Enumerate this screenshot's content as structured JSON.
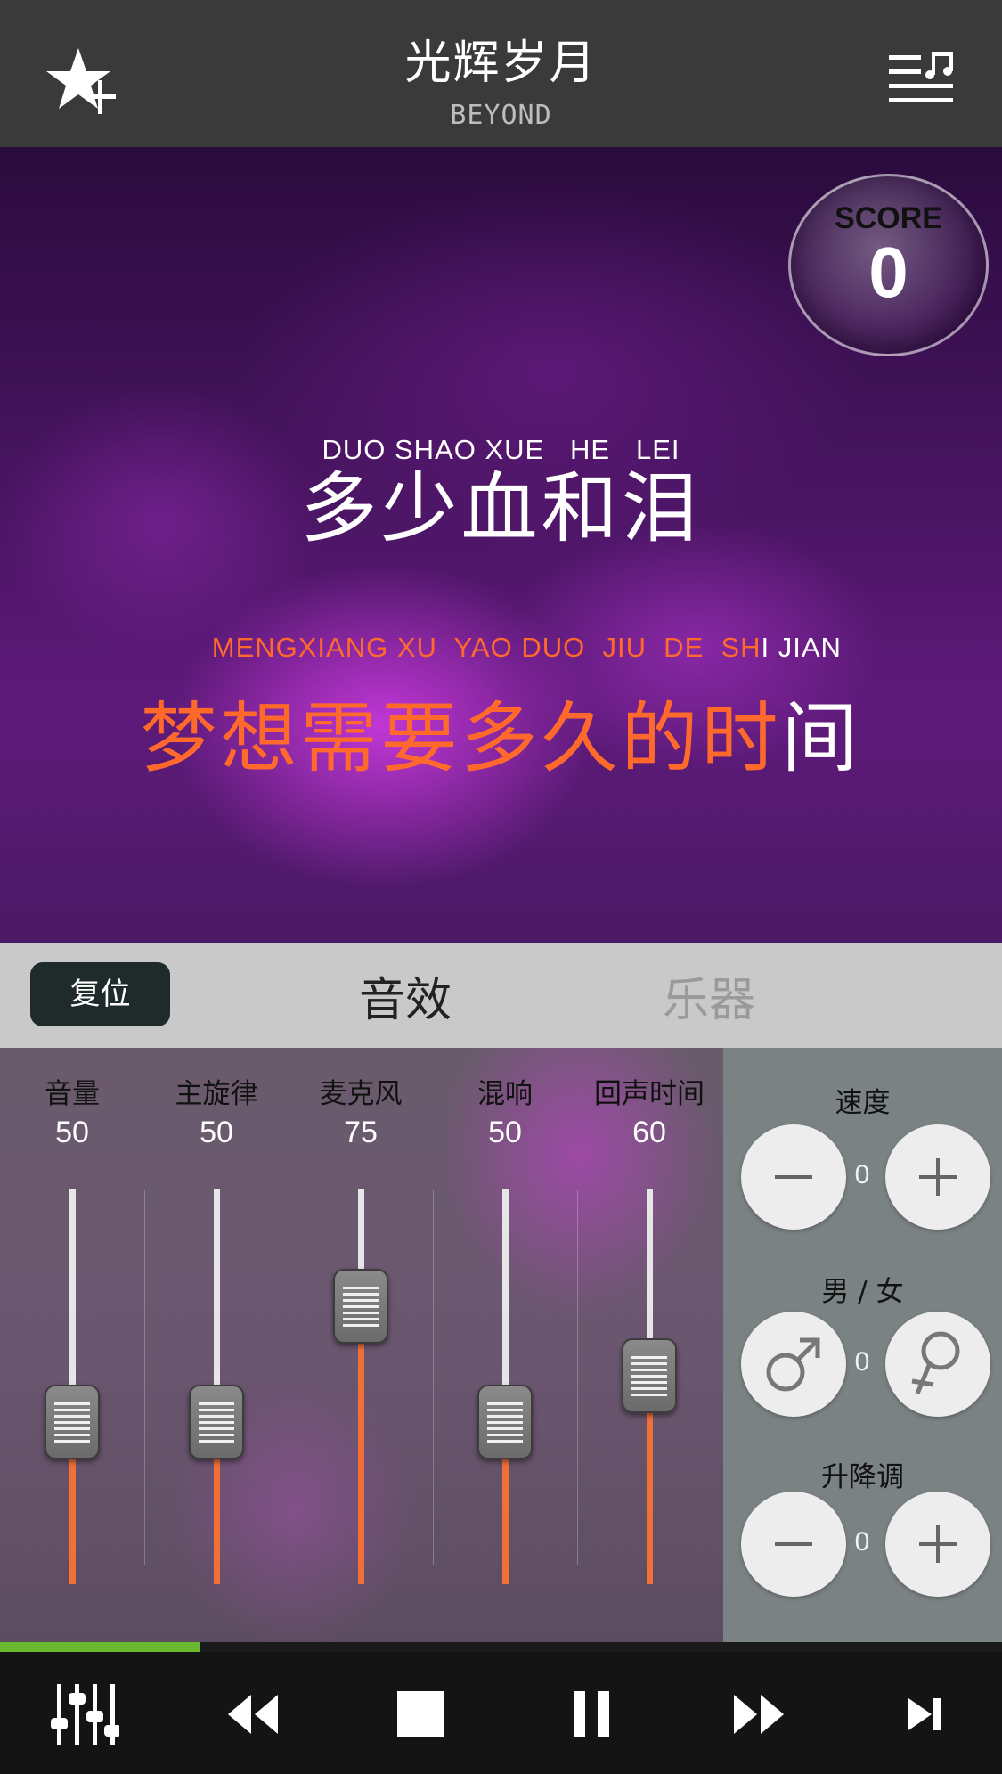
{
  "header": {
    "title": "光辉岁月",
    "artist": "BEYOND",
    "icons": {
      "favorite": "star-plus-icon",
      "playlist": "music-list-icon"
    }
  },
  "stage": {
    "score_label": "SCORE",
    "score_value": "0",
    "line1": {
      "pinyin": "DUO SHAO XUE   HE   LEI",
      "hanzi": "多少血和泪"
    },
    "line2": {
      "pinyin_sung": "MENGXIANG XU  YAO DUO  JIU  DE  SH",
      "pinyin_unsung": "I JIAN",
      "hanzi_sung": "梦想需要多久的时",
      "hanzi_unsung": "间"
    },
    "colors": {
      "sung": "#ff6a2c",
      "unsung": "#ffffff"
    }
  },
  "tabs": {
    "reset_label": "复位",
    "effects_label": "音效",
    "instruments_label": "乐器"
  },
  "mixer": {
    "channels": [
      {
        "label": "音量",
        "value": "50",
        "level": 50
      },
      {
        "label": "主旋律",
        "value": "50",
        "level": 50
      },
      {
        "label": "麦克风",
        "value": "75",
        "level": 75
      },
      {
        "label": "混响",
        "value": "50",
        "level": 50
      },
      {
        "label": "回声时间",
        "value": "60",
        "level": 60
      }
    ]
  },
  "controls": {
    "speed": {
      "label": "速度",
      "value": "0"
    },
    "gender": {
      "label": "男 / 女",
      "value": "0"
    },
    "pitch": {
      "label": "升降调",
      "value": "0"
    }
  },
  "playback": {
    "progress_fraction": 0.2,
    "icons": [
      "equalizer-icon",
      "rewind-icon",
      "stop-icon",
      "pause-icon",
      "fast-forward-icon",
      "next-track-icon"
    ]
  }
}
